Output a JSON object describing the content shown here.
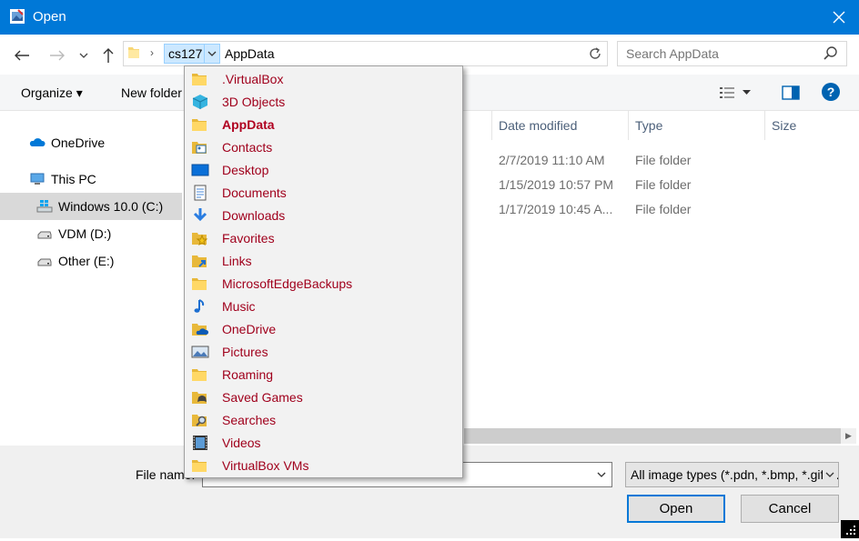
{
  "window": {
    "title": "Open"
  },
  "address": {
    "crumbs": [
      "cs127",
      "AppData"
    ],
    "search_placeholder": "Search AppData"
  },
  "toolbar": {
    "organize_label": "Organize ▾",
    "new_folder_label": "New folder"
  },
  "nav_pane": {
    "items": [
      {
        "label": "OneDrive"
      },
      {
        "label": "This PC"
      },
      {
        "label": "Windows 10.0 (C:)"
      },
      {
        "label": "VDM (D:)"
      },
      {
        "label": "Other (E:)"
      }
    ]
  },
  "file_list": {
    "columns": [
      "Date modified",
      "Type",
      "Size"
    ],
    "rows": [
      {
        "date": "2/7/2019 11:10 AM",
        "type": "File folder"
      },
      {
        "date": "1/15/2019 10:57 PM",
        "type": "File folder"
      },
      {
        "date": "1/17/2019 10:45 A...",
        "type": "File folder"
      }
    ]
  },
  "dropdown": {
    "items": [
      {
        "label": ".VirtualBox",
        "icon": "folder-icon"
      },
      {
        "label": "3D Objects",
        "icon": "3d-objects-icon"
      },
      {
        "label": "AppData",
        "icon": "folder-icon"
      },
      {
        "label": "Contacts",
        "icon": "contacts-icon"
      },
      {
        "label": "Desktop",
        "icon": "desktop-icon"
      },
      {
        "label": "Documents",
        "icon": "documents-icon"
      },
      {
        "label": "Downloads",
        "icon": "downloads-icon"
      },
      {
        "label": "Favorites",
        "icon": "favorites-icon"
      },
      {
        "label": "Links",
        "icon": "links-icon"
      },
      {
        "label": "MicrosoftEdgeBackups",
        "icon": "folder-icon"
      },
      {
        "label": "Music",
        "icon": "music-icon"
      },
      {
        "label": "OneDrive",
        "icon": "onedrive-folder-icon"
      },
      {
        "label": "Pictures",
        "icon": "pictures-icon"
      },
      {
        "label": "Roaming",
        "icon": "folder-icon"
      },
      {
        "label": "Saved Games",
        "icon": "saved-games-icon"
      },
      {
        "label": "Searches",
        "icon": "searches-icon"
      },
      {
        "label": "Videos",
        "icon": "videos-icon"
      },
      {
        "label": "VirtualBox VMs",
        "icon": "folder-icon"
      }
    ]
  },
  "bottom": {
    "file_name_label": "File name:",
    "file_type": "All image types (*.pdn, *.bmp, *.gif, *.jpg)",
    "open_label": "Open",
    "cancel_label": "Cancel"
  },
  "colors": {
    "titlebar": "#0078d7",
    "selection": "#cce8ff",
    "dropdown_text": "#a0001c"
  }
}
